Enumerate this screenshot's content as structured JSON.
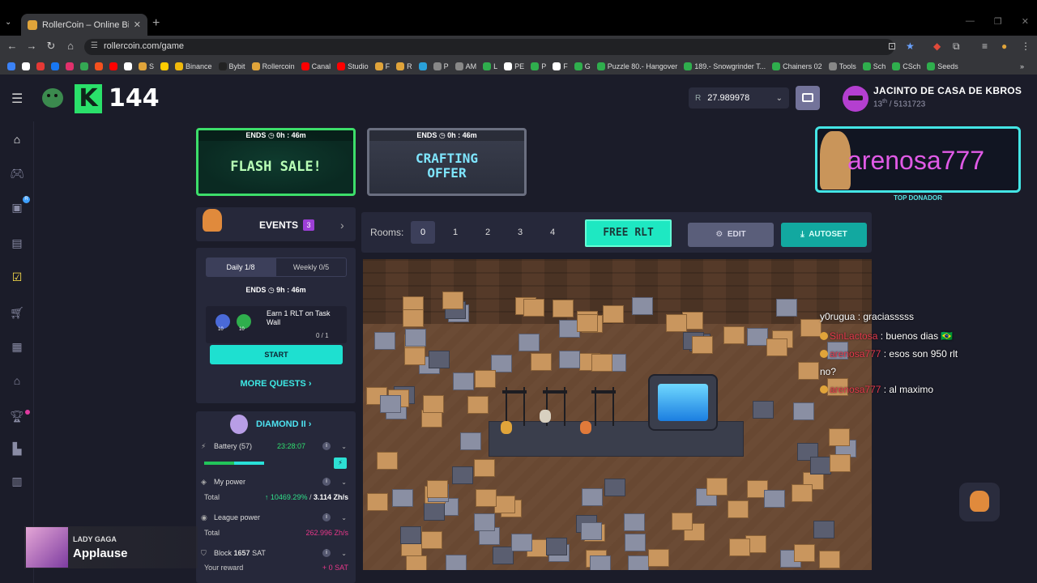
{
  "browser": {
    "tab_title": "RollerCoin – Online Bitcoin Mi",
    "url": "rollercoin.com/game",
    "bookmarks": [
      {
        "label": "",
        "color": "#3b82f6"
      },
      {
        "label": "",
        "color": "#ffffff"
      },
      {
        "label": "",
        "color": "#e53935"
      },
      {
        "label": "",
        "color": "#1877f2"
      },
      {
        "label": "",
        "color": "#e1306c"
      },
      {
        "label": "",
        "color": "#34a853"
      },
      {
        "label": "",
        "color": "#f4511e"
      },
      {
        "label": "",
        "color": "#ff0000"
      },
      {
        "label": "",
        "color": "#ffffff"
      },
      {
        "label": "S",
        "color": "#e0a43a"
      },
      {
        "label": "",
        "color": "#ffcc00"
      },
      {
        "label": "Binance",
        "color": "#f0b90b"
      },
      {
        "label": "Bybit",
        "color": "#222222"
      },
      {
        "label": "Rollercoin",
        "color": "#e0a43a"
      },
      {
        "label": "Canal",
        "color": "#ff0000"
      },
      {
        "label": "Studio",
        "color": "#ff0000"
      },
      {
        "label": "F",
        "color": "#e0a43a"
      },
      {
        "label": "R",
        "color": "#e0a43a"
      },
      {
        "label": "",
        "color": "#2aa1d9"
      },
      {
        "label": "P",
        "color": "#888888"
      },
      {
        "label": "AM",
        "color": "#888888"
      },
      {
        "label": "L",
        "color": "#2fae4d"
      },
      {
        "label": "PE",
        "color": "#ffffff"
      },
      {
        "label": "P",
        "color": "#2fae4d"
      },
      {
        "label": "F",
        "color": "#ffffff"
      },
      {
        "label": "G",
        "color": "#2fae4d"
      },
      {
        "label": "Puzzle 80.- Hangover",
        "color": "#2fae4d"
      },
      {
        "label": "189.- Snowgrinder T...",
        "color": "#2fae4d"
      },
      {
        "label": "Chainers 02",
        "color": "#2fae4d"
      },
      {
        "label": "Tools",
        "color": "#888888"
      },
      {
        "label": "Sch",
        "color": "#2fae4d"
      },
      {
        "label": "CSch",
        "color": "#2fae4d"
      },
      {
        "label": "Seeds",
        "color": "#2fae4d"
      }
    ],
    "bookmarks_more": "»"
  },
  "header": {
    "k_letter": "K",
    "k_value": "144",
    "balance_prefix": "R",
    "balance": "27.989978",
    "username": "JACINTO DE CASA DE KBROS",
    "rank": "13",
    "rank_suffix": "th",
    "rank_total": "/ 5131723"
  },
  "sidebar": {
    "icons": [
      "home-icon",
      "gamepad-icon",
      "rlt-icon",
      "store-icon",
      "calendar-icon",
      "cart-icon",
      "inventory-icon",
      "marketplace-icon",
      "trophy-icon",
      "miner-icon",
      "news-icon"
    ],
    "badge_r": "R"
  },
  "banners": {
    "flash": {
      "ends": "ENDS ◷ 0h : 46m",
      "title": "FLASH SALE!"
    },
    "craft": {
      "ends": "ENDS ◷ 0h : 46m",
      "title_line1": "CRAFTING",
      "title_line2": "OFFER"
    }
  },
  "donor": {
    "name": "arenosa777",
    "label": "TOP DONADOR"
  },
  "events": {
    "label": "EVENTS",
    "count": "3",
    "tab_daily": "Daily  1/8",
    "tab_weekly": "Weekly  0/5",
    "ends": "ENDS  ◷  9h : 46m",
    "task_ic1_label": "10",
    "task_ic2_label": "10",
    "task_text": "Earn 1 RLT on Task Wall",
    "task_progress": "0 / 1",
    "start_label": "START",
    "more_quests": "MORE QUESTS ›"
  },
  "league": {
    "label": "DIAMOND II ›",
    "battery_label": "Battery (57)",
    "battery_time": "23:28:07",
    "battery_level": 0.5,
    "my_power_label": "My power",
    "total_label": "Total",
    "power_pct": "↑ 10469.29%",
    "power_sep": " / ",
    "power_zh": "3.114 Zh/s",
    "league_power_label": "League power",
    "league_total_label": "Total",
    "league_power_val": "262.996 Zh/s",
    "block_label": "Block",
    "block_value": "1657",
    "block_unit": "SAT",
    "reward_label": "Your reward",
    "reward_val": "+ 0 SAT"
  },
  "rooms": {
    "label": "Rooms:",
    "items": [
      "0",
      "1",
      "2",
      "3",
      "4"
    ],
    "active": "0",
    "free_rlt": "FREE RLT",
    "edit": "EDIT",
    "autoset": "AUTOSET"
  },
  "chat": [
    {
      "name": "y0rugua",
      "text": " : graciasssss",
      "pink": false
    },
    {
      "name": "SinLactosa",
      "text": " : buenos dias 🇧🇷",
      "pink": true
    },
    {
      "name": "arenosa777",
      "text": " : esos son 950 rlt",
      "pink": true
    },
    {
      "name": "",
      "text": "no?",
      "pink": false
    },
    {
      "name": "arenosa777",
      "text": " : al maximo",
      "pink": true
    }
  ],
  "music": {
    "artist": "LADY GAGA",
    "title": "Applause"
  }
}
